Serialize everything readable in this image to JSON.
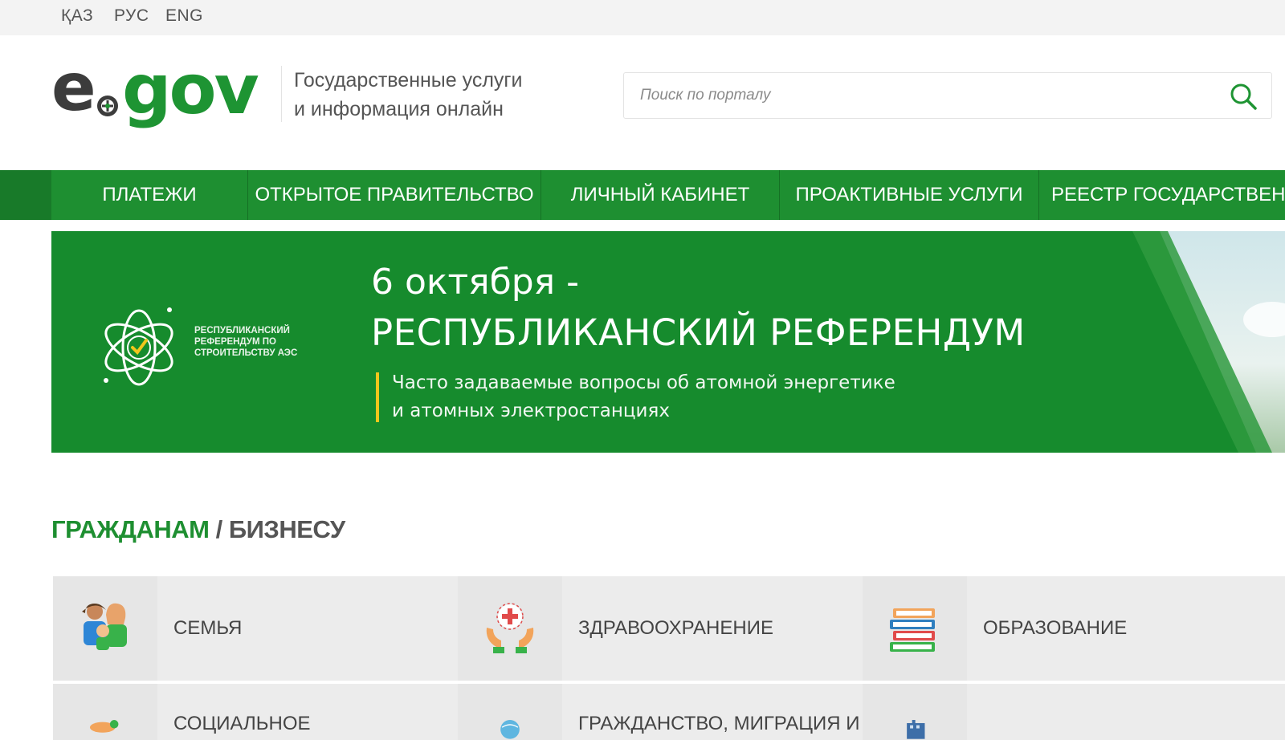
{
  "languages": [
    "ҚАЗ",
    "РУС",
    "ENG"
  ],
  "header": {
    "logo_e": "e",
    "logo_gov": "gov",
    "tagline_line1": "Государственные услуги",
    "tagline_line2": "и информация онлайн",
    "search_placeholder": "Поиск по порталу"
  },
  "nav": {
    "items": [
      "ПЛАТЕЖИ",
      "ОТКРЫТОЕ ПРАВИТЕЛЬСТВО",
      "ЛИЧНЫЙ КАБИНЕТ",
      "ПРОАКТИВНЫЕ УСЛУГИ",
      "РЕЕСТР ГОСУДАРСТВЕНН"
    ]
  },
  "banner": {
    "mark_text": "РЕСПУБЛИКАНСКИЙ РЕФЕРЕНДУМ ПО СТРОИТЕЛЬСТВУ АЭС",
    "date": "6 октября -",
    "headline": "РЕСПУБЛИКАНСКИЙ РЕФЕРЕНДУМ",
    "sub_line1": "Часто задаваемые вопросы об атомной энергетике",
    "sub_line2": "и атомных электростанциях"
  },
  "section": {
    "citizens": "ГРАЖДАНАМ",
    "slash": " / ",
    "business": "БИЗНЕСУ"
  },
  "categories": [
    {
      "label": "СЕМЬЯ",
      "icon": "family-icon"
    },
    {
      "label": "ЗДРАВООХРАНЕНИЕ",
      "icon": "healthcare-icon"
    },
    {
      "label": "ОБРАЗОВАНИЕ",
      "icon": "education-icon"
    },
    {
      "label": "СОЦИАЛЬНОЕ",
      "icon": "social-icon"
    },
    {
      "label": "ГРАЖДАНСТВО, МИГРАЦИЯ И",
      "icon": "citizenship-icon"
    },
    {
      "label": "",
      "icon": "building-icon"
    }
  ],
  "colors": {
    "brand_green": "#1e8f31",
    "banner_green": "#168b2d",
    "accent_yellow": "#f2c61c"
  }
}
